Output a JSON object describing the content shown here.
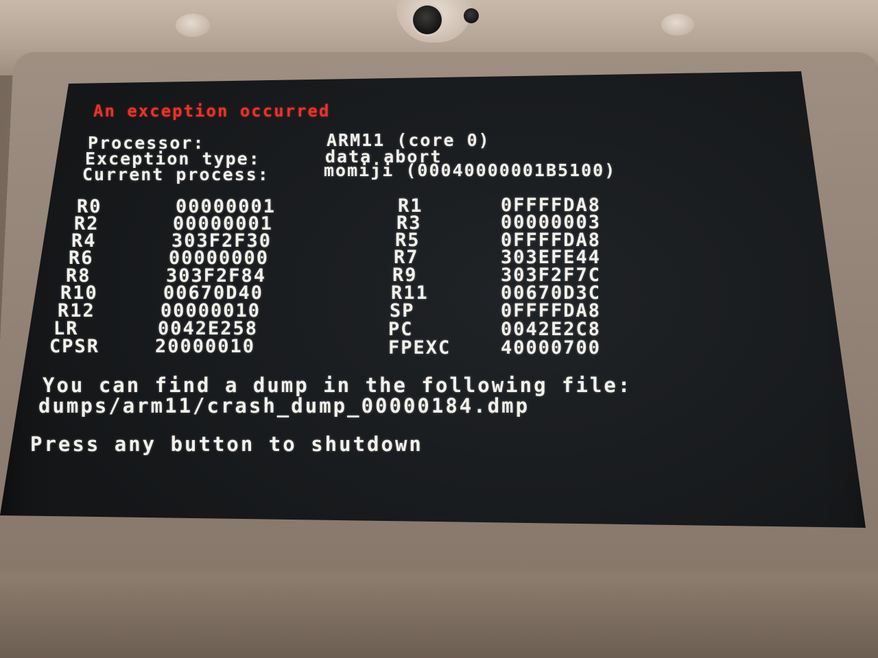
{
  "crash_screen": {
    "title": "An exception occurred",
    "info": {
      "processor_label": "Processor:",
      "processor_value": "ARM11 (core 0)",
      "exception_type_label": "Exception type:",
      "exception_type_value": "data abort",
      "current_process_label": "Current process:",
      "current_process_value": "momiji (00040000001B5100)"
    },
    "registers_left": [
      {
        "name": "R0",
        "value": "00000001"
      },
      {
        "name": "R2",
        "value": "00000001"
      },
      {
        "name": "R4",
        "value": "303F2F30"
      },
      {
        "name": "R6",
        "value": "00000000"
      },
      {
        "name": "R8",
        "value": "303F2F84"
      },
      {
        "name": "R10",
        "value": "00670D40"
      },
      {
        "name": "R12",
        "value": "00000010"
      },
      {
        "name": "LR",
        "value": "0042E258"
      },
      {
        "name": "CPSR",
        "value": "20000010"
      }
    ],
    "registers_right": [
      {
        "name": "R1",
        "value": "0FFFFDA8"
      },
      {
        "name": "R3",
        "value": "00000003"
      },
      {
        "name": "R5",
        "value": "0FFFFDA8"
      },
      {
        "name": "R7",
        "value": "303EFE44"
      },
      {
        "name": "R9",
        "value": "303F2F7C"
      },
      {
        "name": "R11",
        "value": "00670D3C"
      },
      {
        "name": "SP",
        "value": "0FFFFDA8"
      },
      {
        "name": "PC",
        "value": "0042E2C8"
      },
      {
        "name": "FPEXC",
        "value": "40000700"
      }
    ],
    "dump_message": "You can find a dump in the following file:",
    "dump_path": "dumps/arm11/crash_dump_00000184.dmp",
    "shutdown_prompt": "Press any button to shutdown"
  },
  "colors": {
    "title_red": "#e8332b",
    "text_white": "#f3f1ec",
    "screen_bg": "#141618"
  }
}
